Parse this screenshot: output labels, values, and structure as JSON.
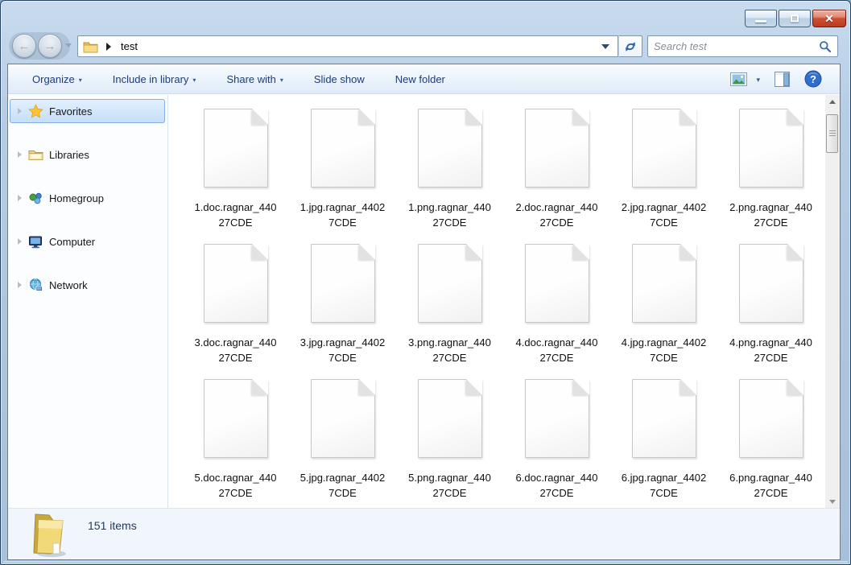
{
  "titlebar": {
    "controls": {
      "minimize": "minimize",
      "maximize": "maximize",
      "close": "close"
    }
  },
  "navigation": {
    "breadcrumb": {
      "location": "test"
    },
    "search": {
      "placeholder": "Search test"
    }
  },
  "icons": {
    "dropdown_arrow": "▾",
    "back": "back-arrow",
    "forward": "forward-arrow",
    "refresh": "refresh-arrows",
    "search": "magnifier",
    "views": "picture-thumbnail",
    "preview": "preview-pane",
    "help": "?"
  },
  "toolbar": {
    "items": [
      {
        "label": "Organize",
        "dropdown": true
      },
      {
        "label": "Include in library",
        "dropdown": true
      },
      {
        "label": "Share with",
        "dropdown": true
      },
      {
        "label": "Slide show",
        "dropdown": false
      },
      {
        "label": "New folder",
        "dropdown": false
      }
    ]
  },
  "sidebar": {
    "items": [
      {
        "label": "Favorites",
        "icon": "star-icon",
        "selected": true
      },
      {
        "label": "Libraries",
        "icon": "libraries-folder-icon",
        "selected": false
      },
      {
        "label": "Homegroup",
        "icon": "homegroup-icon",
        "selected": false
      },
      {
        "label": "Computer",
        "icon": "computer-icon",
        "selected": false
      },
      {
        "label": "Network",
        "icon": "network-globe-icon",
        "selected": false
      }
    ]
  },
  "files": {
    "view": "large-icons",
    "items": [
      {
        "line1": "1.doc.ragnar_440",
        "line2": "27CDE"
      },
      {
        "line1": "1.jpg.ragnar_4402",
        "line2": "7CDE"
      },
      {
        "line1": "1.png.ragnar_440",
        "line2": "27CDE"
      },
      {
        "line1": "2.doc.ragnar_440",
        "line2": "27CDE"
      },
      {
        "line1": "2.jpg.ragnar_4402",
        "line2": "7CDE"
      },
      {
        "line1": "2.png.ragnar_440",
        "line2": "27CDE"
      },
      {
        "line1": "3.doc.ragnar_440",
        "line2": "27CDE"
      },
      {
        "line1": "3.jpg.ragnar_4402",
        "line2": "7CDE"
      },
      {
        "line1": "3.png.ragnar_440",
        "line2": "27CDE"
      },
      {
        "line1": "4.doc.ragnar_440",
        "line2": "27CDE"
      },
      {
        "line1": "4.jpg.ragnar_4402",
        "line2": "7CDE"
      },
      {
        "line1": "4.png.ragnar_440",
        "line2": "27CDE"
      },
      {
        "line1": "5.doc.ragnar_440",
        "line2": "27CDE"
      },
      {
        "line1": "5.jpg.ragnar_4402",
        "line2": "7CDE"
      },
      {
        "line1": "5.png.ragnar_440",
        "line2": "27CDE"
      },
      {
        "line1": "6.doc.ragnar_440",
        "line2": "27CDE"
      },
      {
        "line1": "6.jpg.ragnar_4402",
        "line2": "7CDE"
      },
      {
        "line1": "6.png.ragnar_440",
        "line2": "27CDE"
      }
    ]
  },
  "statusbar": {
    "item_count": "151 items"
  },
  "colors": {
    "glass_blue": "#aec6e0",
    "toolbar_text": "#1e3c78",
    "selection_border": "#84aede",
    "selection_fill": "#c6defa",
    "close_button_red": "#cd4f33",
    "status_bg": "#f1f6fc"
  }
}
